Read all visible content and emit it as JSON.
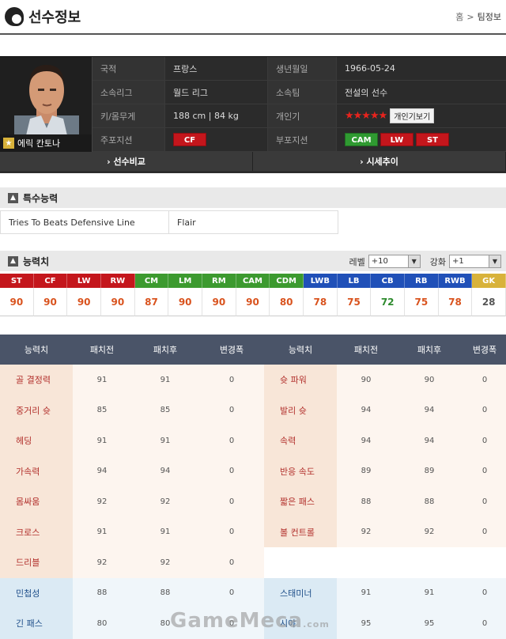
{
  "header": {
    "title": "선수정보",
    "crumb_home": "홈",
    "crumb_sep": ">",
    "crumb_current": "팀정보"
  },
  "player": {
    "name": "에릭 칸토나",
    "labels": {
      "nation": "국적",
      "birth": "생년월일",
      "league": "소속리그",
      "team": "소속팀",
      "size": "키/몸무게",
      "skill": "개인기",
      "main_pos": "주포지션",
      "sub_pos": "부포지션"
    },
    "nation": "프랑스",
    "birth": "1966-05-24",
    "league": "월드 리그",
    "team": "전설의 선수",
    "size": "188 cm | 84 kg",
    "skill_stars": "★★★★★",
    "skill_button": "개인기보기",
    "main_positions": [
      "CF"
    ],
    "sub_positions": [
      "CAM",
      "LW",
      "ST"
    ]
  },
  "buttons": {
    "compare": "› 선수비교",
    "trend": "› 시세추이"
  },
  "special": {
    "title": "특수능력",
    "traits": [
      "Tries To Beats Defensive Line",
      "Flair"
    ]
  },
  "ability": {
    "title": "능력치",
    "level_label": "레벨",
    "level_value": "+10",
    "enhance_label": "강화",
    "enhance_value": "+1",
    "positions": [
      {
        "pos": "ST",
        "val": "90",
        "color": "#c4161c",
        "vcolor": "#d9531e"
      },
      {
        "pos": "CF",
        "val": "90",
        "color": "#c4161c",
        "vcolor": "#d9531e"
      },
      {
        "pos": "LW",
        "val": "90",
        "color": "#c4161c",
        "vcolor": "#d9531e"
      },
      {
        "pos": "RW",
        "val": "90",
        "color": "#c4161c",
        "vcolor": "#d9531e"
      },
      {
        "pos": "CM",
        "val": "87",
        "color": "#3c9a2f",
        "vcolor": "#d9531e"
      },
      {
        "pos": "LM",
        "val": "90",
        "color": "#3c9a2f",
        "vcolor": "#d9531e"
      },
      {
        "pos": "RM",
        "val": "90",
        "color": "#3c9a2f",
        "vcolor": "#d9531e"
      },
      {
        "pos": "CAM",
        "val": "90",
        "color": "#3c9a2f",
        "vcolor": "#d9531e"
      },
      {
        "pos": "CDM",
        "val": "80",
        "color": "#3c9a2f",
        "vcolor": "#d9531e"
      },
      {
        "pos": "LWB",
        "val": "78",
        "color": "#2050b8",
        "vcolor": "#d9531e"
      },
      {
        "pos": "LB",
        "val": "75",
        "color": "#2050b8",
        "vcolor": "#d9531e"
      },
      {
        "pos": "CB",
        "val": "72",
        "color": "#2050b8",
        "vcolor": "#2e8b2e"
      },
      {
        "pos": "RB",
        "val": "75",
        "color": "#2050b8",
        "vcolor": "#d9531e"
      },
      {
        "pos": "RWB",
        "val": "78",
        "color": "#2050b8",
        "vcolor": "#d9531e"
      },
      {
        "pos": "GK",
        "val": "28",
        "color": "#d8b23a",
        "vcolor": "#555555"
      }
    ]
  },
  "stats": {
    "headers": [
      "능력치",
      "패치전",
      "패치후",
      "변경폭",
      "능력치",
      "패치전",
      "패치후",
      "변경폭"
    ],
    "rows": [
      {
        "cat": "r",
        "l": [
          "골 결정력",
          "91",
          "91",
          "0"
        ],
        "r": [
          "슛 파워",
          "90",
          "90",
          "0"
        ]
      },
      {
        "cat": "r",
        "l": [
          "중거리 슛",
          "85",
          "85",
          "0"
        ],
        "r": [
          "발리 슛",
          "94",
          "94",
          "0"
        ]
      },
      {
        "cat": "r",
        "l": [
          "헤딩",
          "91",
          "91",
          "0"
        ],
        "r": [
          "속력",
          "94",
          "94",
          "0"
        ]
      },
      {
        "cat": "r",
        "l": [
          "가속력",
          "94",
          "94",
          "0"
        ],
        "r": [
          "반응 속도",
          "89",
          "89",
          "0"
        ]
      },
      {
        "cat": "r",
        "l": [
          "몸싸움",
          "92",
          "92",
          "0"
        ],
        "r": [
          "짧은 패스",
          "88",
          "88",
          "0"
        ]
      },
      {
        "cat": "r",
        "l": [
          "크로스",
          "91",
          "91",
          "0"
        ],
        "r": [
          "볼 컨트롤",
          "92",
          "92",
          "0"
        ]
      },
      {
        "cat": "r",
        "l": [
          "드리블",
          "92",
          "92",
          "0"
        ],
        "r": null
      },
      {
        "cat": "b",
        "l": [
          "민첩성",
          "88",
          "88",
          "0"
        ],
        "r": [
          "스태미너",
          "91",
          "91",
          "0"
        ]
      },
      {
        "cat": "b",
        "l": [
          "긴 패스",
          "80",
          "80",
          "0"
        ],
        "r": [
          "시야",
          "95",
          "95",
          "0"
        ]
      }
    ]
  },
  "watermark": "GameMeca",
  "watermark_suffix": ".com"
}
